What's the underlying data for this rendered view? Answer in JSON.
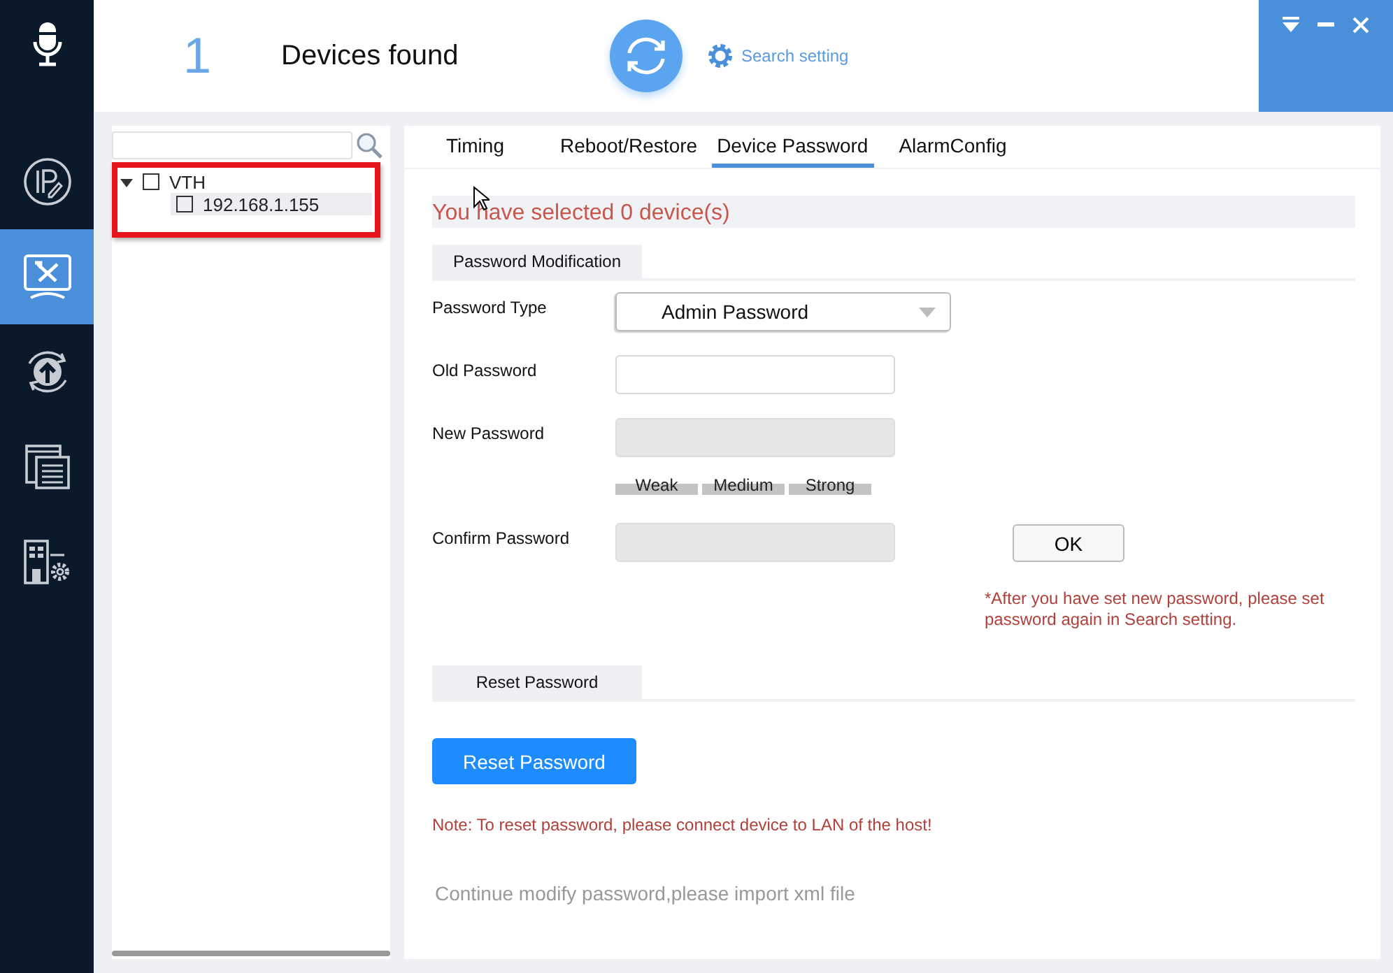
{
  "nav": [
    {
      "kind": "mic",
      "selected": false
    },
    {
      "kind": "ip",
      "selected": false
    },
    {
      "kind": "tools",
      "selected": true
    },
    {
      "kind": "upgrade",
      "selected": false
    },
    {
      "kind": "windows",
      "selected": false
    },
    {
      "kind": "building",
      "selected": false
    }
  ],
  "header": {
    "count": "1",
    "title": "Devices found",
    "search_setting": "Search setting"
  },
  "tree": {
    "items": [
      {
        "label": "VTH",
        "checked": false,
        "expanded": true,
        "selected": false,
        "children": [
          {
            "label": "192.168.1.155",
            "checked": false,
            "selected": true
          }
        ]
      }
    ]
  },
  "tabs": [
    {
      "label": "Timing",
      "selected": false
    },
    {
      "label": "Reboot/Restore",
      "selected": false
    },
    {
      "label": "Device Password",
      "selected": true
    },
    {
      "label": "AlarmConfig",
      "selected": false
    }
  ],
  "selection_notice": "You have selected 0 device(s)",
  "password_section": {
    "title": "Password Modification",
    "fields": [
      {
        "kind": "select",
        "label": "Password Type",
        "value": "Admin Password"
      },
      {
        "kind": "input",
        "label": "Old Password",
        "disabled": false
      },
      {
        "kind": "input",
        "label": "New Password",
        "disabled": true
      },
      {
        "kind": "strength",
        "levels": [
          "Weak",
          "Medium",
          "Strong"
        ]
      },
      {
        "kind": "input",
        "label": "Confirm Password",
        "disabled": true
      }
    ],
    "ok_button": "OK",
    "note": "*After you have set new password, please set password again in Search setting."
  },
  "reset_section": {
    "title": "Reset Password",
    "button": "Reset Password",
    "note": "Note: To reset password, please connect device to LAN of the host!",
    "import_hint": "Continue modify password,please import xml file"
  }
}
